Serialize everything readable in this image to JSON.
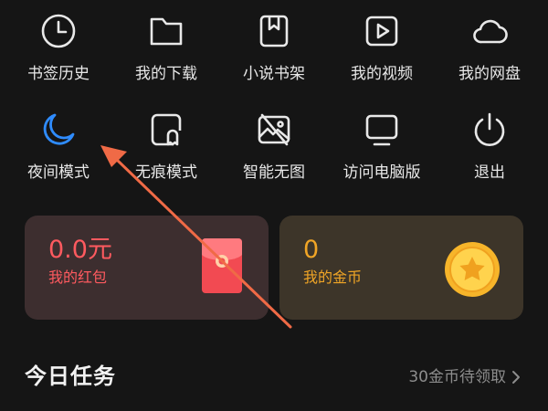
{
  "menu": {
    "row1": [
      {
        "label": "书签历史",
        "icon": "clock-icon"
      },
      {
        "label": "我的下载",
        "icon": "folder-icon"
      },
      {
        "label": "小说书架",
        "icon": "bookmark-book-icon"
      },
      {
        "label": "我的视频",
        "icon": "play-icon"
      },
      {
        "label": "我的网盘",
        "icon": "cloud-icon"
      }
    ],
    "row2": [
      {
        "label": "夜间模式",
        "icon": "moon-icon"
      },
      {
        "label": "无痕模式",
        "icon": "ghost-icon"
      },
      {
        "label": "智能无图",
        "icon": "no-image-icon"
      },
      {
        "label": "访问电脑版",
        "icon": "monitor-icon"
      },
      {
        "label": "退出",
        "icon": "power-icon"
      }
    ]
  },
  "cards": {
    "red_packet": {
      "amount": "0.0元",
      "label": "我的红包",
      "color": "#ff5a5f"
    },
    "coins": {
      "amount": "0",
      "label": "我的金币",
      "color": "#f0a526"
    }
  },
  "tasks": {
    "title": "今日任务",
    "link": "30金币待领取"
  },
  "colors": {
    "background": "#151515",
    "accent_blue": "#2f8cff",
    "annotation_arrow": "#f06a46"
  }
}
